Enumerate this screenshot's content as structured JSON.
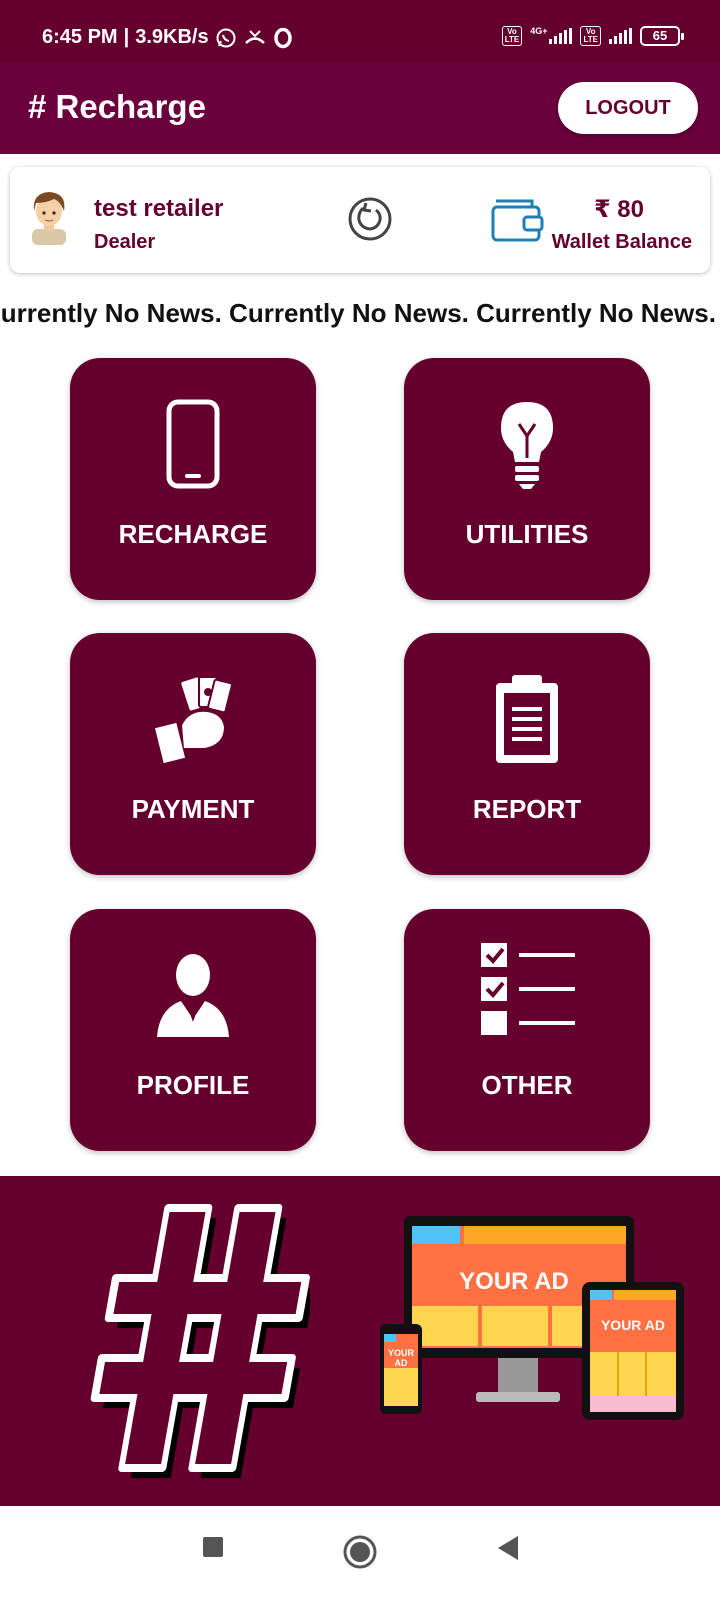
{
  "status_bar": {
    "time": "6:45 PM",
    "speed": "3.9KB/s",
    "volte_label": "Vo\nLTE",
    "network_type": "4G+",
    "battery": "65"
  },
  "app_bar": {
    "title": "# Recharge",
    "logout_label": "LOGOUT"
  },
  "user": {
    "name": "test retailer",
    "role": "Dealer",
    "wallet_amount": "₹ 80",
    "wallet_label": "Wallet Balance"
  },
  "ticker": {
    "text": "Currently No News. Currently No News. Currently No News."
  },
  "menu": {
    "recharge": "RECHARGE",
    "utilities": "UTILITIES",
    "payment": "PAYMENT",
    "report": "REPORT",
    "profile": "PROFILE",
    "other": "OTHER"
  },
  "banner": {
    "ad_large": "YOUR AD",
    "ad_tablet": "YOUR AD",
    "ad_phone_1": "YOUR",
    "ad_phone_2": "AD"
  },
  "colors": {
    "primary": "#65002e",
    "app_bar": "#6a003c",
    "wallet_icon": "#1e7fb5"
  }
}
